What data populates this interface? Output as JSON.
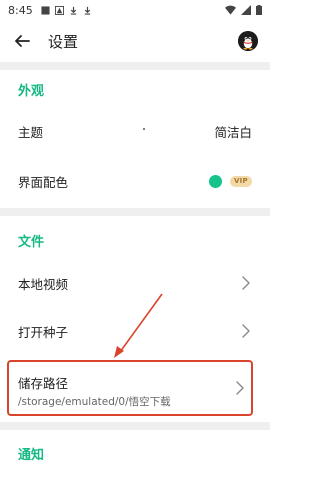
{
  "status_bar": {
    "time": "8:45"
  },
  "app_bar": {
    "title": "设置"
  },
  "sections": {
    "appearance": {
      "header": "外观",
      "theme_label": "主题",
      "theme_value": "简洁白",
      "color_label": "界面配色",
      "color_value_hex": "#16c38a",
      "vip_badge": "VIP"
    },
    "files": {
      "header": "文件",
      "local_video_label": "本地视频",
      "open_seed_label": "打开种子",
      "storage_label": "储存路径",
      "storage_path": "/storage/emulated/0/悟空下载"
    },
    "notifications": {
      "header": "通知"
    }
  },
  "colors": {
    "accent": "#16b985",
    "highlight": "#d9452c"
  },
  "icons": {
    "back": "arrow-left-icon",
    "avatar": "penguin-avatar",
    "chevron": "chevron-right-icon"
  }
}
